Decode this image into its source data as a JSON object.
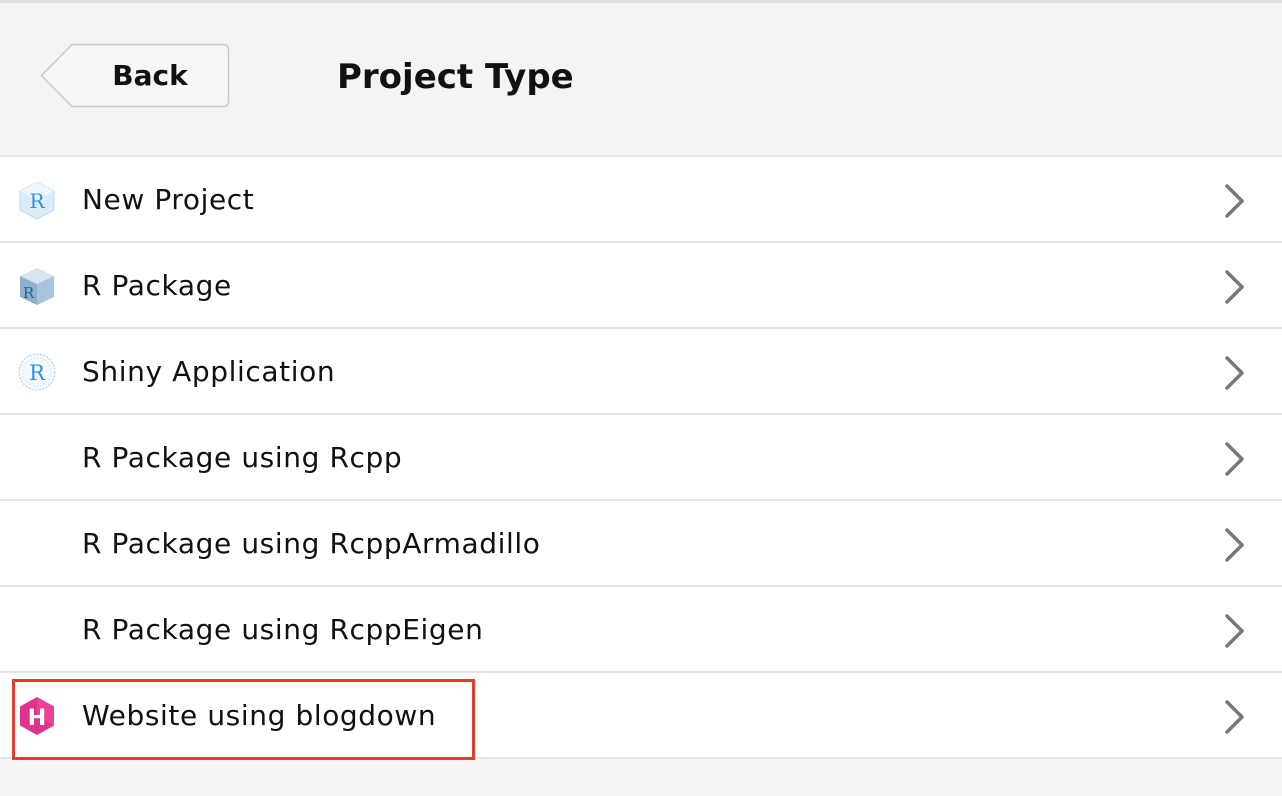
{
  "header": {
    "back_label": "Back",
    "title": "Project Type"
  },
  "project_types": [
    {
      "label": "New Project",
      "icon": "r-project-icon"
    },
    {
      "label": "R Package",
      "icon": "r-package-icon"
    },
    {
      "label": "Shiny Application",
      "icon": "shiny-icon"
    },
    {
      "label": "R Package using Rcpp",
      "icon": ""
    },
    {
      "label": "R Package using RcppArmadillo",
      "icon": ""
    },
    {
      "label": "R Package using RcppEigen",
      "icon": ""
    },
    {
      "label": "Website using blogdown",
      "icon": "hugo-icon",
      "highlighted": true
    }
  ],
  "icons": {
    "r_letter": "R",
    "hugo_letter": "H"
  },
  "colors": {
    "header_bg": "#f4f4f4",
    "row_bg": "#ffffff",
    "divider": "#e6e6e6",
    "chevron": "#777777",
    "highlight_border": "#d9402f",
    "hugo_pink": "#e0338e",
    "r_blue": "#2f8fd8"
  }
}
